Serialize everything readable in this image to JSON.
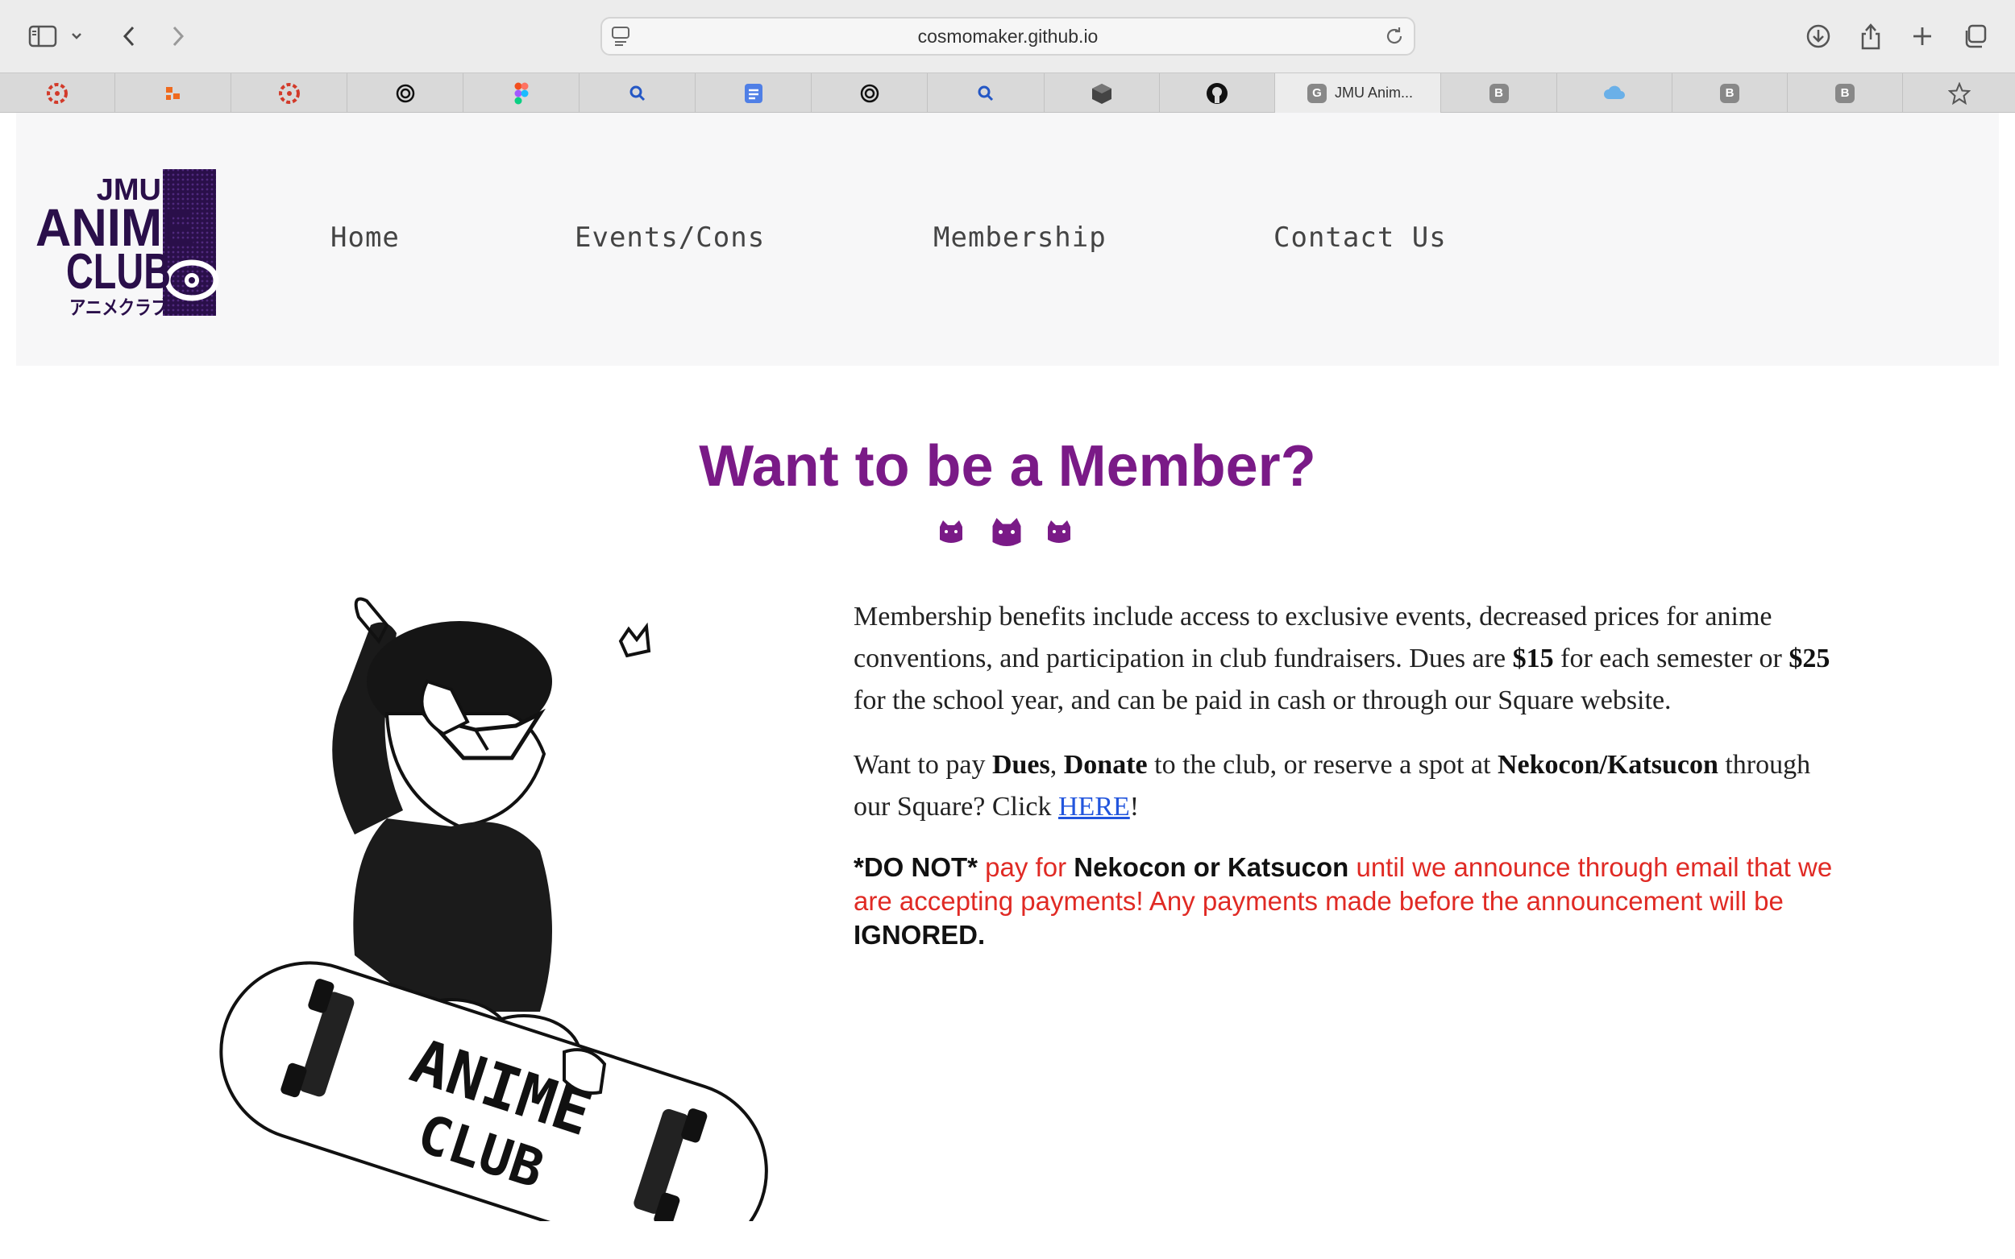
{
  "browser": {
    "url": "cosmomaker.github.io",
    "active_tab_title": "JMU Anim...",
    "active_tab_favicon": "G",
    "b_favicon": "B"
  },
  "site": {
    "logo": {
      "line1": "JMU",
      "line2": "ANIME",
      "line3": "CLUB",
      "kana": "アニメクラブ"
    },
    "nav": {
      "home": "Home",
      "events": "Events/Cons",
      "membership": "Membership",
      "contact": "Contact Us"
    }
  },
  "page": {
    "headline": "Want to be a Member?",
    "p1": {
      "a": "Membership benefits include access to exclusive events, decreased prices for anime conventions, and participation in club fundraisers. Dues are ",
      "b1": "$15",
      "c": " for each semester or ",
      "b2": "$25",
      "d": " for the school year, and can be paid in cash or through our Square website."
    },
    "p2": {
      "a": "Want to pay ",
      "b1": "Dues",
      "c": ", ",
      "b2": "Donate",
      "d": " to the club, or reserve a spot at ",
      "b3": "Nekocon/Katsucon",
      "e": " through our Square? Click ",
      "link": "HERE",
      "f": "!"
    },
    "warning": {
      "b1": "*DO NOT*",
      "a": " pay for ",
      "b2": "Nekocon or Katsucon",
      "c": " until we announce through email that we are accepting payments! Any payments made before the announcement will be ",
      "b3": "IGNORED."
    },
    "illustration_text": {
      "line1": "ANIME",
      "line2": "CLUB"
    }
  },
  "colors": {
    "headline": "#7a1a87",
    "warning": "#e02a24",
    "link": "#2255dd",
    "logo_purple": "#2a0f4a"
  }
}
